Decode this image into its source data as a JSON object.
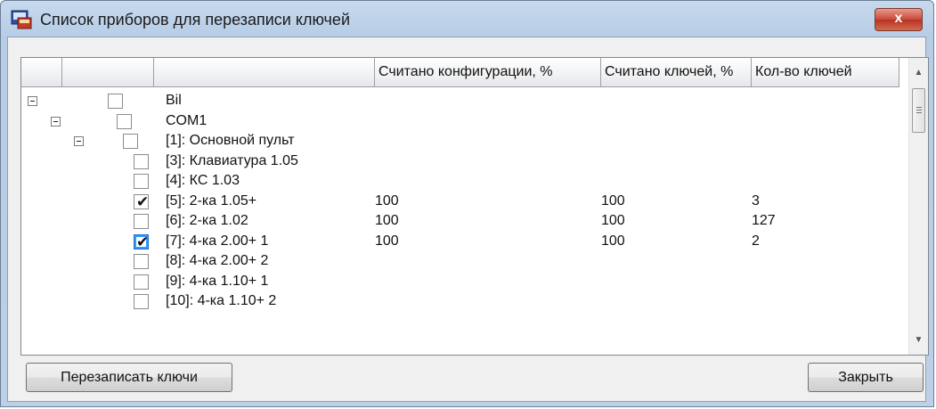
{
  "window": {
    "title": "Список приборов для перезаписи ключей",
    "close_label": "x"
  },
  "table": {
    "columns": [
      "",
      "",
      "",
      "Считано конфигурации, %",
      "Считано ключей, %",
      "Кол-во ключей"
    ],
    "rows": [
      {
        "level": 0,
        "expander": true,
        "checked": false,
        "selected": false,
        "name": "Bil",
        "config": "",
        "keys_read": "",
        "key_count": ""
      },
      {
        "level": 1,
        "expander": true,
        "checked": false,
        "selected": false,
        "name": "COM1",
        "config": "",
        "keys_read": "",
        "key_count": ""
      },
      {
        "level": 2,
        "expander": true,
        "checked": false,
        "selected": false,
        "name": "[1]: Основной пульт",
        "config": "",
        "keys_read": "",
        "key_count": ""
      },
      {
        "level": 3,
        "expander": false,
        "checked": false,
        "selected": false,
        "name": "[3]: Клавиатура 1.05",
        "config": "",
        "keys_read": "",
        "key_count": ""
      },
      {
        "level": 3,
        "expander": false,
        "checked": false,
        "selected": false,
        "name": "[4]: КС 1.03",
        "config": "",
        "keys_read": "",
        "key_count": ""
      },
      {
        "level": 3,
        "expander": false,
        "checked": true,
        "selected": false,
        "name": "[5]: 2-ка 1.05+",
        "config": "100",
        "keys_read": "100",
        "key_count": "3"
      },
      {
        "level": 3,
        "expander": false,
        "checked": false,
        "selected": false,
        "name": "[6]: 2-ка 1.02",
        "config": "100",
        "keys_read": "100",
        "key_count": "127"
      },
      {
        "level": 3,
        "expander": false,
        "checked": true,
        "selected": true,
        "name": "[7]: 4-ка 2.00+ 1",
        "config": "100",
        "keys_read": "100",
        "key_count": "2"
      },
      {
        "level": 3,
        "expander": false,
        "checked": false,
        "selected": false,
        "name": "[8]: 4-ка 2.00+ 2",
        "config": "",
        "keys_read": "",
        "key_count": ""
      },
      {
        "level": 3,
        "expander": false,
        "checked": false,
        "selected": false,
        "name": "[9]: 4-ка 1.10+ 1",
        "config": "",
        "keys_read": "",
        "key_count": ""
      },
      {
        "level": 3,
        "expander": false,
        "checked": false,
        "selected": false,
        "name": "[10]: 4-ка 1.10+ 2",
        "config": "",
        "keys_read": "",
        "key_count": ""
      }
    ]
  },
  "buttons": {
    "rewrite": "Перезаписать ключи",
    "close": "Закрыть"
  },
  "icons": {
    "app": "device-window-icon",
    "scroll_up": "scroll-up-arrow-icon",
    "scroll_down": "scroll-down-arrow-icon"
  }
}
